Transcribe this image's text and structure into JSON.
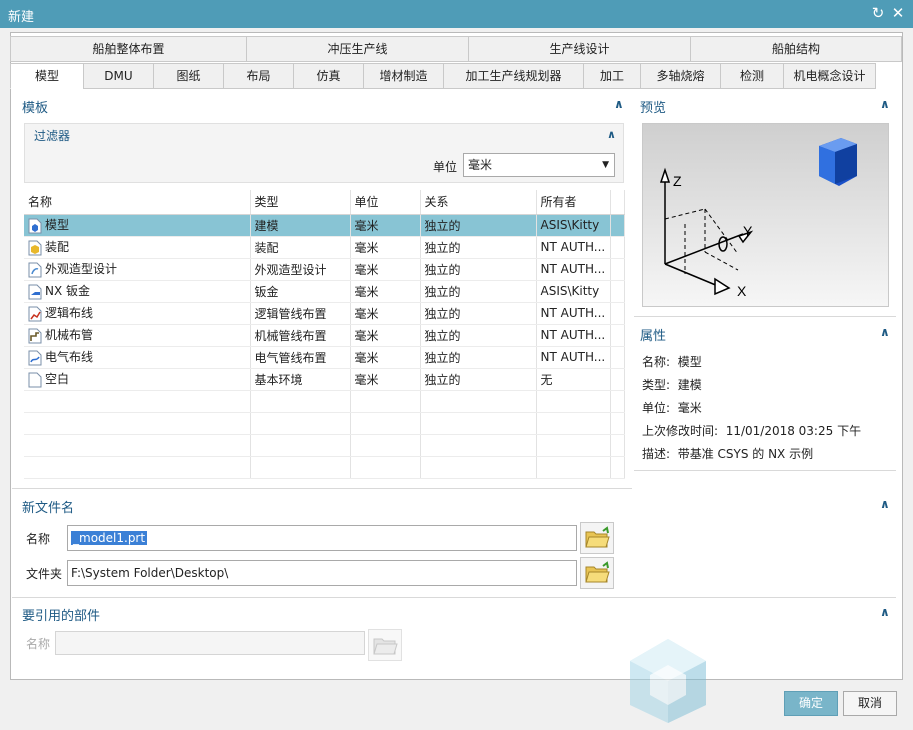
{
  "window": {
    "title": "新建",
    "restore_icon": "refresh-icon",
    "close_icon": "close-icon"
  },
  "tabs_top": [
    "船舶整体布置",
    "冲压生产线",
    "生产线设计",
    "船舶结构"
  ],
  "tabs_bottom": [
    "模型",
    "DMU",
    "图纸",
    "布局",
    "仿真",
    "增材制造",
    "加工生产线规划器",
    "加工",
    "多轴烧熔",
    "检测",
    "机电概念设计"
  ],
  "active_tab": "模型",
  "template": {
    "title": "模板",
    "filter": {
      "title": "过滤器",
      "unit_label": "单位",
      "unit_value": "毫米"
    },
    "columns": [
      "名称",
      "类型",
      "单位",
      "关系",
      "所有者"
    ],
    "rows": [
      {
        "name": "模型",
        "type": "建模",
        "unit": "毫米",
        "relation": "独立的",
        "owner": "ASIS\\Kitty",
        "icon": "model-icon"
      },
      {
        "name": "装配",
        "type": "装配",
        "unit": "毫米",
        "relation": "独立的",
        "owner": "NT AUTH...",
        "icon": "assembly-icon"
      },
      {
        "name": "外观造型设计",
        "type": "外观造型设计",
        "unit": "毫米",
        "relation": "独立的",
        "owner": "NT AUTH...",
        "icon": "shape-studio-icon"
      },
      {
        "name": "NX 钣金",
        "type": "钣金",
        "unit": "毫米",
        "relation": "独立的",
        "owner": "ASIS\\Kitty",
        "icon": "sheet-metal-icon"
      },
      {
        "name": "逻辑布线",
        "type": "逻辑管线布置",
        "unit": "毫米",
        "relation": "独立的",
        "owner": "NT AUTH...",
        "icon": "logical-routing-icon"
      },
      {
        "name": "机械布管",
        "type": "机械管线布置",
        "unit": "毫米",
        "relation": "独立的",
        "owner": "NT AUTH...",
        "icon": "mechanical-routing-icon"
      },
      {
        "name": "电气布线",
        "type": "电气管线布置",
        "unit": "毫米",
        "relation": "独立的",
        "owner": "NT AUTH...",
        "icon": "electrical-routing-icon"
      },
      {
        "name": "空白",
        "type": "基本环境",
        "unit": "毫米",
        "relation": "独立的",
        "owner": "无",
        "icon": "blank-file-icon"
      }
    ]
  },
  "preview": {
    "title": "预览",
    "axis_z": "Z",
    "axis_y": "Y",
    "axis_x": "X"
  },
  "properties": {
    "title": "属性",
    "name_label": "名称:",
    "name_value": "模型",
    "type_label": "类型:",
    "type_value": "建模",
    "unit_label": "单位:",
    "unit_value": "毫米",
    "modified_label": "上次修改时间:",
    "modified_value": "11/01/2018 03:25 下午",
    "desc_label": "描述:",
    "desc_value": "带基准 CSYS 的 NX 示例"
  },
  "new_file": {
    "title": "新文件名",
    "name_label": "名称",
    "name_value": "_model1.prt",
    "folder_label": "文件夹",
    "folder_value": "F:\\System Folder\\Desktop\\"
  },
  "reference": {
    "title": "要引用的部件",
    "name_label": "名称",
    "name_value": ""
  },
  "buttons": {
    "ok": "确定",
    "cancel": "取消"
  },
  "accent": "#4f9cb7",
  "selection_color": "#88c4d4",
  "section_title_color": "#1e5a84"
}
